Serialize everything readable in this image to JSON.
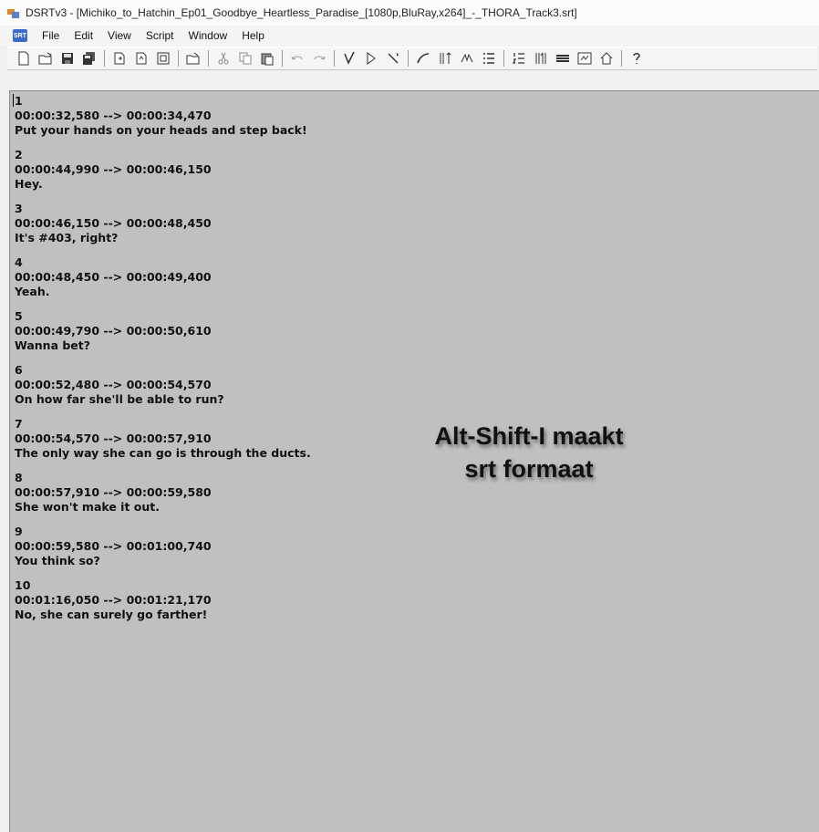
{
  "window": {
    "title": "DSRTv3 - [Michiko_to_Hatchin_Ep01_Goodbye_Heartless_Paradise_[1080p,BluRay,x264]_-_THORA_Track3.srt]",
    "app_icon": "dsrt-app-icon",
    "menu_icon_label": "SRT"
  },
  "menu": {
    "items": [
      "File",
      "Edit",
      "View",
      "Script",
      "Window",
      "Help"
    ]
  },
  "toolbar": {
    "icons": [
      "new-file-icon",
      "open-file-icon",
      "save-icon",
      "save-all-icon",
      "new-subtitle-icon",
      "copy-subtitle-icon",
      "paste-subtitle-icon",
      "import-icon",
      "cut-icon",
      "copy-icon",
      "paste-icon",
      "undo-icon",
      "redo-icon",
      "spellcheck-icon",
      "play-icon",
      "wand-icon",
      "sync-icon",
      "split-icon",
      "merge-icon",
      "list-icon",
      "numbered-list-icon",
      "sort-icon",
      "bar-icon",
      "video-icon",
      "home-icon",
      "help-icon"
    ]
  },
  "subtitles": [
    {
      "index": "1",
      "time": "00:00:32,580 --> 00:00:34,470",
      "text": "Put your hands on your heads and step back!"
    },
    {
      "index": "2",
      "time": "00:00:44,990 --> 00:00:46,150",
      "text": "Hey."
    },
    {
      "index": "3",
      "time": "00:00:46,150 --> 00:00:48,450",
      "text": "It's #403, right?"
    },
    {
      "index": "4",
      "time": "00:00:48,450 --> 00:00:49,400",
      "text": "Yeah."
    },
    {
      "index": "5",
      "time": "00:00:49,790 --> 00:00:50,610",
      "text": "Wanna bet?"
    },
    {
      "index": "6",
      "time": "00:00:52,480 --> 00:00:54,570",
      "text": "On how far she'll be able to run?"
    },
    {
      "index": "7",
      "time": "00:00:54,570 --> 00:00:57,910",
      "text": "The only way she can go is through the ducts."
    },
    {
      "index": "8",
      "time": "00:00:57,910 --> 00:00:59,580",
      "text": "She won't make it out."
    },
    {
      "index": "9",
      "time": "00:00:59,580 --> 00:01:00,740",
      "text": "You think so?"
    },
    {
      "index": "10",
      "time": "00:01:16,050 --> 00:01:21,170",
      "text": "No, she can surely go farther!"
    }
  ],
  "annotation": {
    "line1": "Alt-Shift-I maakt",
    "line2": "srt formaat"
  },
  "colors": {
    "editor_bg": "#c0c0c0",
    "app_accent": "#3b6bc6"
  }
}
